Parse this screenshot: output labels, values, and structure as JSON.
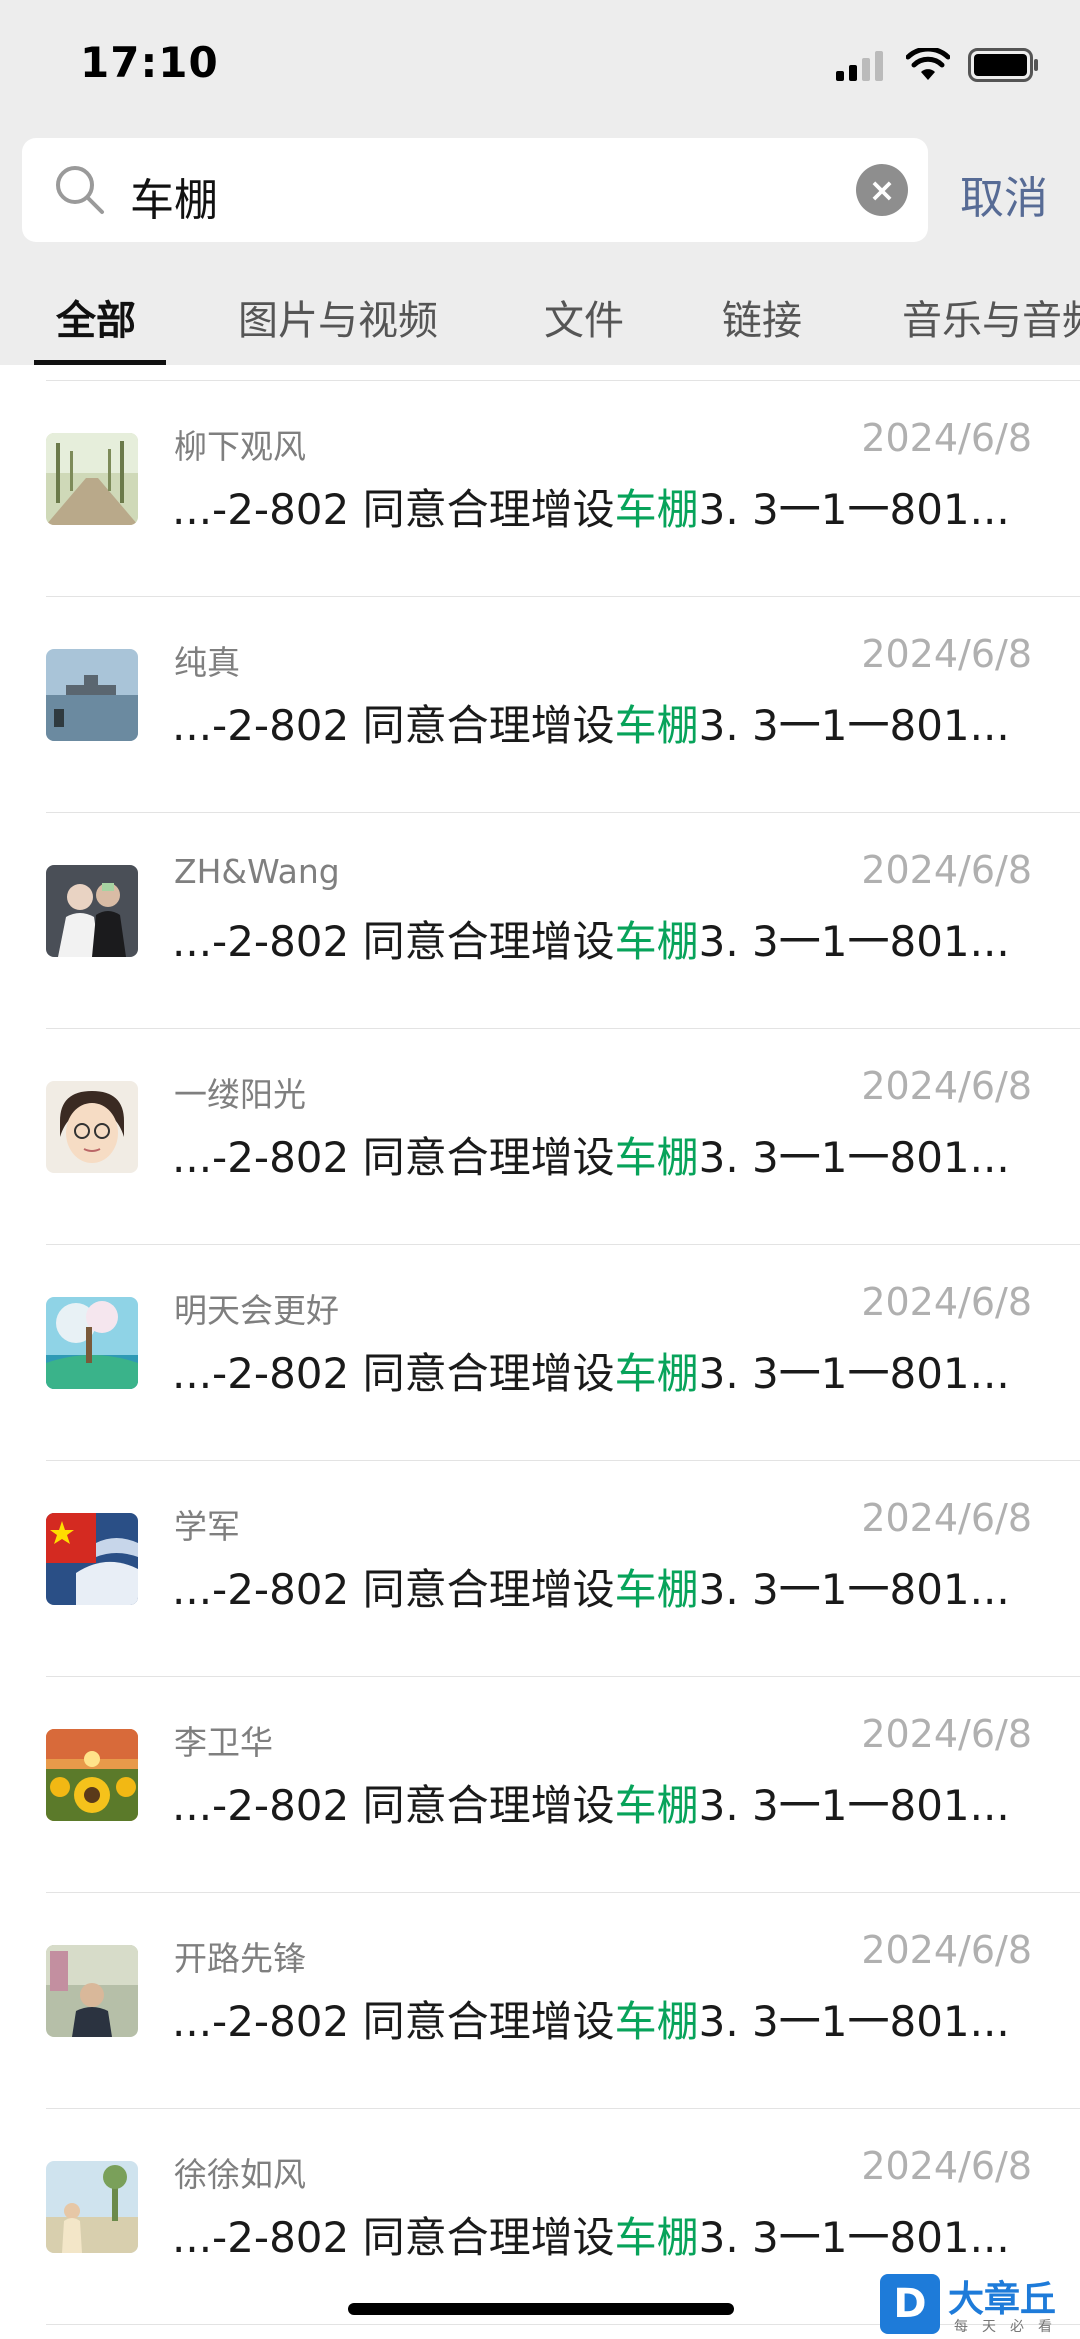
{
  "status_bar": {
    "time": "17:10"
  },
  "search": {
    "query": "车棚",
    "cancel_label": "取消"
  },
  "tabs": [
    "全部",
    "图片与视频",
    "文件",
    "链接",
    "音乐与音频"
  ],
  "snippet": {
    "prefix": "...-2-802 同意合理增设",
    "highlight": "车棚",
    "suffix": "3. 3一1一801..."
  },
  "results": [
    {
      "name": "柳下观风",
      "date": "2024/6/8"
    },
    {
      "name": "纯真",
      "date": "2024/6/8"
    },
    {
      "name": "ZH&Wang",
      "date": "2024/6/8"
    },
    {
      "name": "一缕阳光",
      "date": "2024/6/8"
    },
    {
      "name": "明天会更好",
      "date": "2024/6/8"
    },
    {
      "name": "学军",
      "date": "2024/6/8"
    },
    {
      "name": "李卫华",
      "date": "2024/6/8"
    },
    {
      "name": "开路先锋",
      "date": "2024/6/8"
    },
    {
      "name": "徐徐如风",
      "date": "2024/6/8"
    }
  ],
  "watermark": {
    "brand": "大章丘",
    "slogan": "每天必看",
    "logo": "D"
  },
  "colors": {
    "highlight": "#07a35a",
    "cancel": "#576b95",
    "header_bg": "#ededed"
  }
}
